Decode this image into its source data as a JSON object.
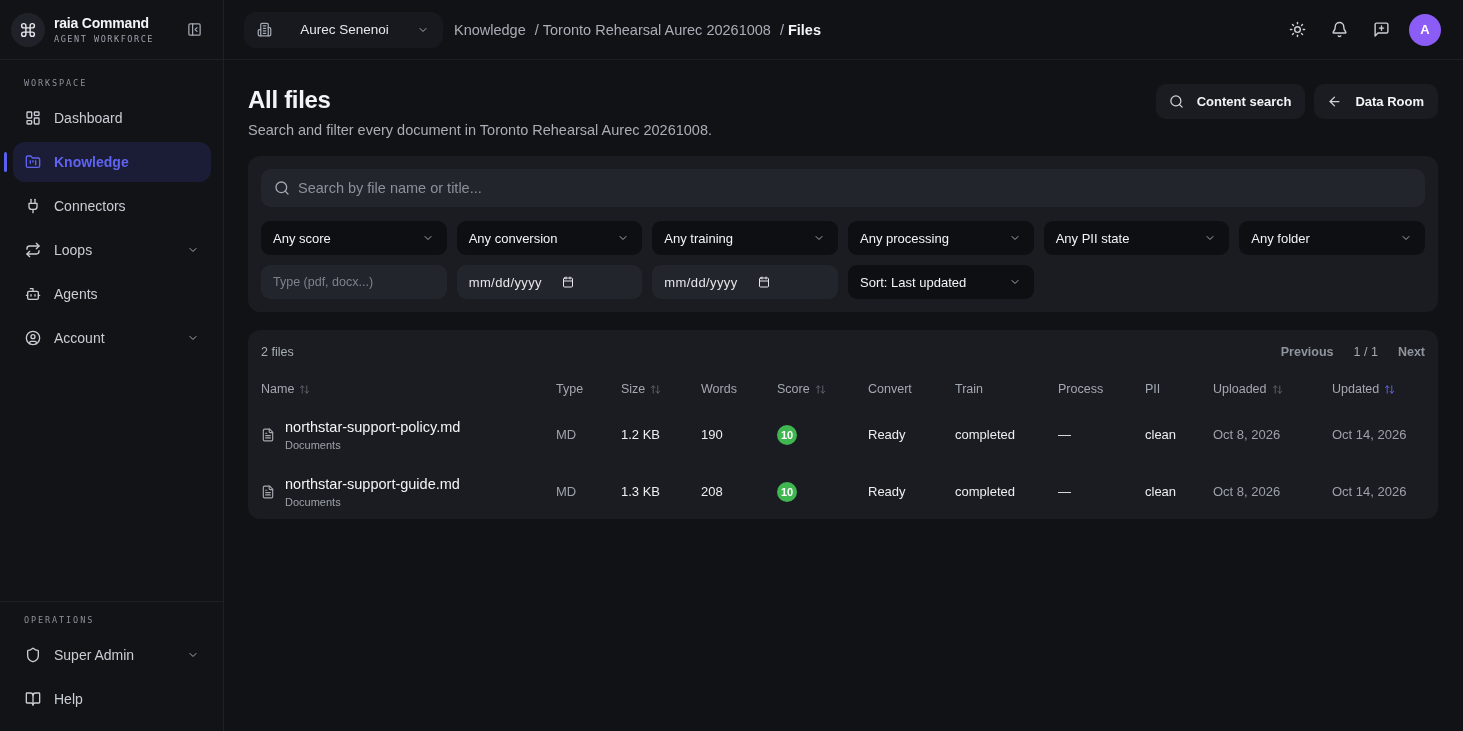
{
  "sidebar": {
    "brand": {
      "title": "raia Command",
      "subtitle": "AGENT WORKFORCE"
    },
    "sections": [
      {
        "label": "WORKSPACE",
        "items": [
          {
            "label": "Dashboard",
            "kind": "link",
            "selected": false
          },
          {
            "label": "Knowledge",
            "kind": "link",
            "selected": true
          },
          {
            "label": "Connectors",
            "kind": "link",
            "selected": false
          },
          {
            "label": "Loops",
            "kind": "group",
            "expanded": false,
            "selected": false
          },
          {
            "label": "Agents",
            "kind": "link",
            "selected": false
          },
          {
            "label": "Account",
            "kind": "group",
            "expanded": false,
            "selected": false
          }
        ]
      },
      {
        "label": "OPERATIONS",
        "items": [
          {
            "label": "Super Admin",
            "kind": "group",
            "expanded": false,
            "selected": false
          },
          {
            "label": "Help",
            "kind": "link",
            "selected": false
          }
        ]
      }
    ]
  },
  "topbar": {
    "workspace": {
      "value": "Aurec Senenoi"
    },
    "breadcrumbs": [
      {
        "label": "Knowledge",
        "current": false
      },
      {
        "separator": "/",
        "label": "Toronto Rehearsal Aurec 20261008",
        "current": false
      },
      {
        "separator": "/",
        "label": "Files",
        "current": true
      }
    ],
    "avatar": {
      "initial": "A"
    }
  },
  "header": {
    "title": "All files",
    "subtitle": "Search and filter every document in Toronto Rehearsal Aurec 20261008.",
    "actions": [
      {
        "kind": "search",
        "label": "Content search"
      },
      {
        "kind": "back",
        "label": "Data Room"
      }
    ]
  },
  "filters": {
    "search": {
      "placeholder": "Search by file name or title..."
    },
    "controls": [
      {
        "kind": "select",
        "value": "Any score"
      },
      {
        "kind": "select",
        "value": "Any conversion"
      },
      {
        "kind": "select",
        "value": "Any training"
      },
      {
        "kind": "select",
        "value": "Any processing"
      },
      {
        "kind": "select",
        "value": "Any PII state"
      },
      {
        "kind": "select",
        "value": "Any folder"
      },
      {
        "kind": "text",
        "placeholder": "Type (pdf, docx...)"
      },
      {
        "kind": "date",
        "placeholder": "mm/dd/yyyy"
      },
      {
        "kind": "date",
        "placeholder": "mm/dd/yyyy"
      },
      {
        "kind": "select",
        "value": "Sort: Last updated"
      }
    ]
  },
  "files": {
    "count": "2 files",
    "pagination": {
      "previous": {
        "label": "Previous",
        "disabled": true
      },
      "page": "1 / 1",
      "next": {
        "label": "Next",
        "disabled": true
      }
    },
    "columns": [
      {
        "label": "Name",
        "sortable": true,
        "selected": false
      },
      {
        "label": "Type",
        "sortable": false,
        "selected": false
      },
      {
        "label": "Size",
        "sortable": true,
        "selected": false
      },
      {
        "label": "Words",
        "sortable": false,
        "selected": false
      },
      {
        "label": "Score",
        "sortable": true,
        "selected": false
      },
      {
        "label": "Convert",
        "sortable": false,
        "selected": false
      },
      {
        "label": "Train",
        "sortable": false,
        "selected": false
      },
      {
        "label": "Process",
        "sortable": false,
        "selected": false
      },
      {
        "label": "PII",
        "sortable": false,
        "selected": false
      },
      {
        "label": "Uploaded",
        "sortable": true,
        "selected": false
      },
      {
        "label": "Updated",
        "sortable": true,
        "selected": true
      }
    ],
    "rows": [
      {
        "name": "northstar-support-policy.md",
        "folder": "Documents",
        "type": "MD",
        "size": "1.2 KB",
        "words": "190",
        "score": "10",
        "convert": "Ready",
        "train": "completed",
        "process": "—",
        "pii": "clean",
        "uploaded": "Oct 8, 2026",
        "updated": "Oct 14, 2026"
      },
      {
        "name": "northstar-support-guide.md",
        "folder": "Documents",
        "type": "MD",
        "size": "1.3 KB",
        "words": "208",
        "score": "10",
        "convert": "Ready",
        "train": "completed",
        "process": "—",
        "pii": "clean",
        "uploaded": "Oct 8, 2026",
        "updated": "Oct 14, 2026"
      }
    ]
  }
}
